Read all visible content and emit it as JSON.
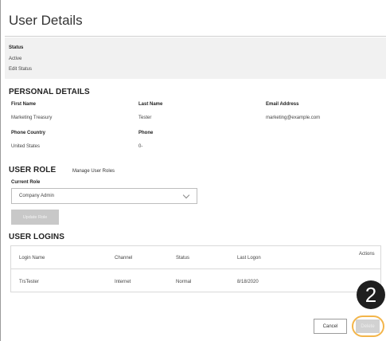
{
  "page": {
    "title": "User Details"
  },
  "status": {
    "label": "Status",
    "value": "Active",
    "edit_link": "Edit Status"
  },
  "personal_details": {
    "heading": "PERSONAL DETAILS",
    "first_name_label": "First Name",
    "first_name": "Marketing Treasury",
    "last_name_label": "Last Name",
    "last_name": "Tester",
    "email_label": "Email Address",
    "email": "marketing@example.com",
    "phone_country_label": "Phone Country",
    "phone_country": "United States",
    "phone_label": "Phone",
    "phone": "0-"
  },
  "user_role": {
    "heading": "USER ROLE",
    "manage_link": "Manage User Roles",
    "current_role_label": "Current Role",
    "current_role": "Company Admin",
    "update_button": "Update Role"
  },
  "user_logins": {
    "heading": "USER LOGINS",
    "columns": [
      "Login Name",
      "Channel",
      "Status",
      "Last Logon",
      "Actions"
    ],
    "rows": [
      {
        "login_name": "TrsTester",
        "channel": "Internet",
        "status": "Normal",
        "last_logon": "8/18/2020"
      }
    ]
  },
  "actions": {
    "cancel": "Cancel",
    "delete": "Delete"
  },
  "callout": {
    "number": "2"
  },
  "colors": {
    "highlight": "#f3b54a",
    "callout_bg": "#1f1f1f",
    "disabled_button": "#c8c8c8"
  }
}
